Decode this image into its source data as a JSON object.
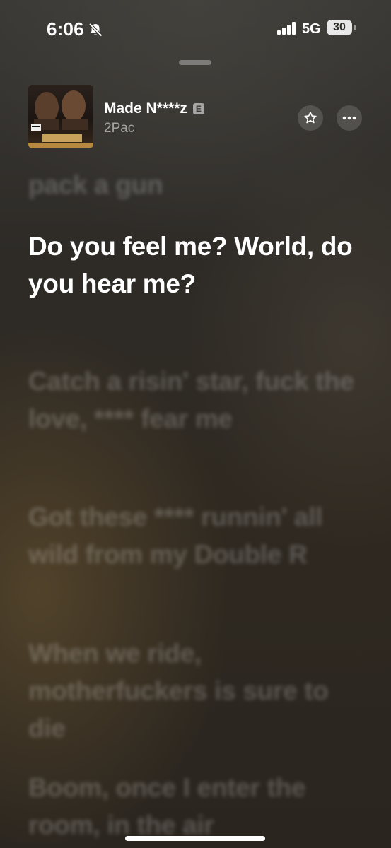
{
  "status_bar": {
    "time": "6:06",
    "network": "5G",
    "battery": "30"
  },
  "now_playing": {
    "title": "Made N****z",
    "explicit_badge": "E",
    "artist": "2Pac",
    "artwork_title": "GANG RELATED",
    "artwork_advisory": "PARENTAL ADVISORY",
    "actions": {
      "favorite_icon": "star-icon",
      "more_icon": "ellipsis-icon"
    }
  },
  "lyrics": {
    "previous": "pack a gun",
    "current": "Do you feel me? World, do you hear me?",
    "upcoming": [
      "Catch a risin' star, fuck the love, **** fear me",
      "Got these **** runnin' all wild from my Double R",
      "When we ride, motherfuckers is sure to die",
      "Boom, once I enter the room, in the air"
    ]
  },
  "colors": {
    "background": "#2b2620",
    "accent_text": "#ffffff",
    "dim_text": "rgba(255,255,255,0.22)"
  }
}
